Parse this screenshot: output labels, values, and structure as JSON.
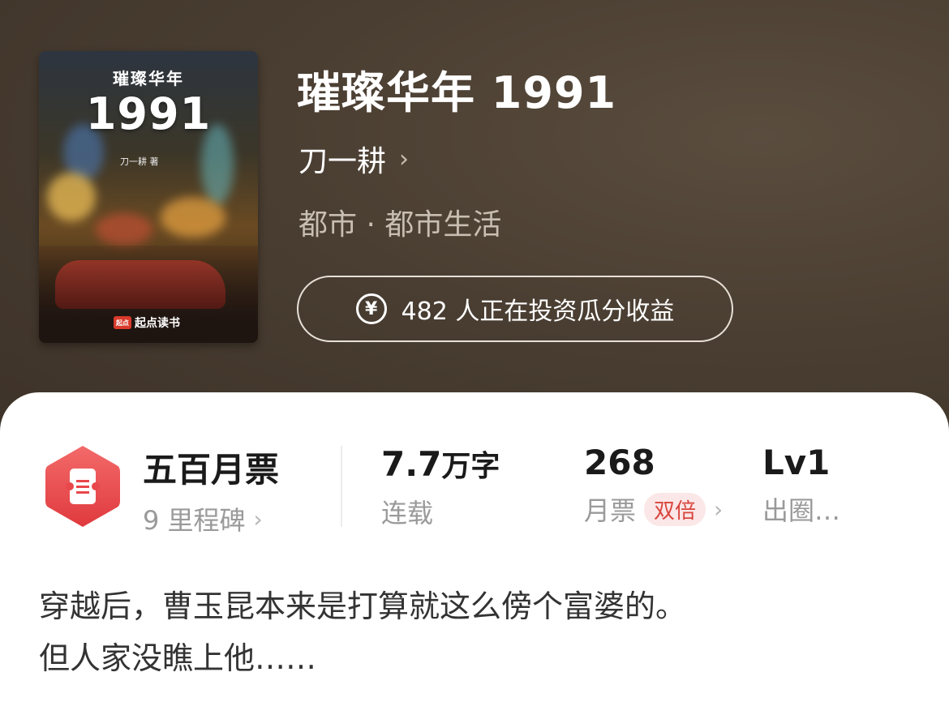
{
  "cover": {
    "title_small": "璀璨华年",
    "title_big": "1991",
    "author": "刀一耕 著",
    "brand_mark": "起点",
    "brand": "起点读书"
  },
  "book": {
    "title": "璀璨华年 1991",
    "author": "刀一耕",
    "genre": "都市 · 都市生活"
  },
  "invest": {
    "icon": "yen-coin-icon",
    "text": "482 人正在投资瓜分收益"
  },
  "stats": {
    "milestone": {
      "title": "五百月票",
      "subtitle": "9 里程碑"
    },
    "words": {
      "number": "7.7",
      "unit": "万字",
      "subtitle": "连载"
    },
    "monthly_tickets": {
      "number": "268",
      "subtitle": "月票",
      "badge": "双倍"
    },
    "level": {
      "number": "Lv1",
      "subtitle": "出圈…"
    }
  },
  "description": {
    "line1": "穿越后，曹玉昆本来是打算就这么傍个富婆的。",
    "line2": "但人家没瞧上他……"
  },
  "colors": {
    "hero_bg": "#4a3f33",
    "accent_red": "#e8474b",
    "badge_bg": "#fbe7e7"
  }
}
